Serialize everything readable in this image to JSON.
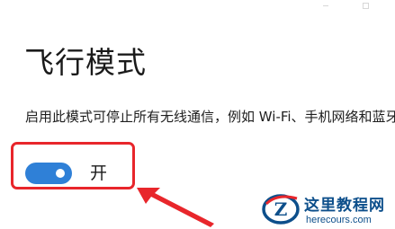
{
  "settings": {
    "title": "飞行模式",
    "description": "启用此模式可停止所有无线通信，例如 Wi-Fi、手机网络和蓝牙",
    "toggle": {
      "state_label": "开",
      "is_on": true
    }
  },
  "colors": {
    "accent": "#2f80d7",
    "highlight": "#e8262b",
    "watermark": "#0d4f8b"
  },
  "icons": {
    "minimize": "minimize-icon",
    "maximize": "maximize-icon",
    "arrow": "red-arrow-icon",
    "watermark_logo": "site-logo-icon"
  },
  "watermark": {
    "name": "这里教程网",
    "url": "herecours.com"
  }
}
